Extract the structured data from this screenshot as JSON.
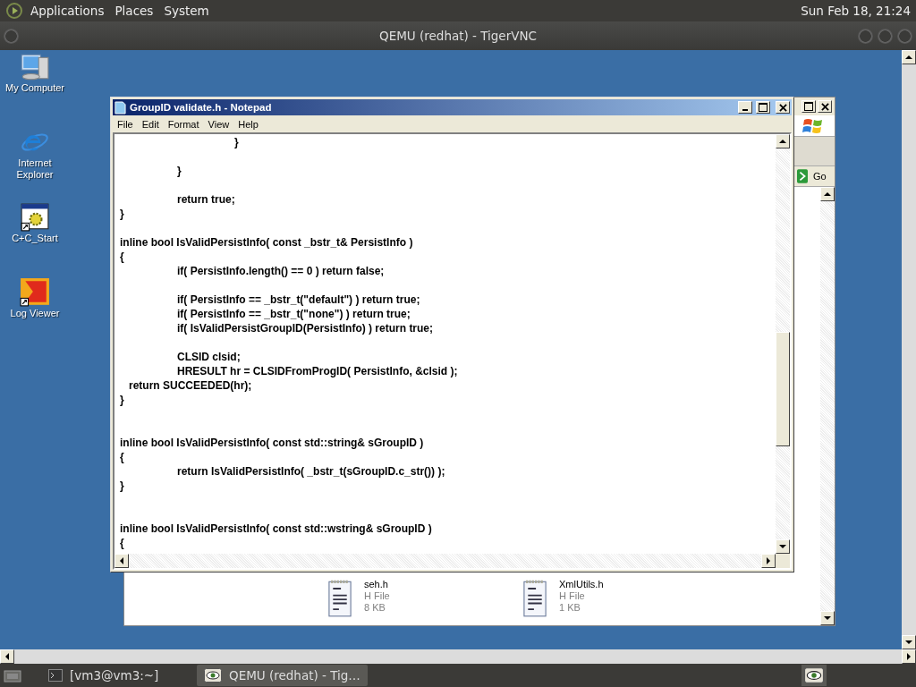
{
  "top_panel": {
    "menus": [
      "Applications",
      "Places",
      "System"
    ],
    "clock": "Sun Feb 18, 21:24"
  },
  "vnc_window": {
    "title": "QEMU (redhat) - TigerVNC"
  },
  "desktop_icons": [
    {
      "label": "My Computer",
      "kind": "computer"
    },
    {
      "label": "Internet Explorer",
      "kind": "browser"
    },
    {
      "label": "C+C_Start",
      "kind": "app"
    },
    {
      "label": "Log Viewer",
      "kind": "viewer"
    }
  ],
  "explorer_window": {
    "go_button": "Go",
    "files": [
      {
        "name": "seh.h",
        "type": "H File",
        "size": "8 KB"
      },
      {
        "name": "XmlUtils.h",
        "type": "H File",
        "size": "1 KB"
      }
    ]
  },
  "notepad": {
    "title": "GroupID validate.h - Notepad",
    "menu": [
      "File",
      "Edit",
      "Format",
      "View",
      "Help"
    ],
    "text": "\t\t}\n\n\t}\n\n\treturn true;\n}\n\ninline bool IsValidPersistInfo( const _bstr_t& PersistInfo )\n{\n\tif( PersistInfo.length() == 0 ) return false;\n\n\tif( PersistInfo == _bstr_t(\"default\") ) return true;\n\tif( PersistInfo == _bstr_t(\"none\") ) return true;\n\tif( IsValidPersistGroupID(PersistInfo) ) return true;\n\n\tCLSID clsid;\n\tHRESULT hr = CLSIDFromProgID( PersistInfo, &clsid );\n   return SUCCEEDED(hr);\n}\n\n\ninline bool IsValidPersistInfo( const std::string& sGroupID )\n{\n\treturn IsValidPersistInfo( _bstr_t(sGroupID.c_str()) );\n}\n\n\ninline bool IsValidPersistInfo( const std::wstring& sGroupID )\n{"
  },
  "taskbar": [
    {
      "label": "[vm3@vm3:~]",
      "kind": "terminal",
      "selected": false
    },
    {
      "label": "QEMU (redhat) - Tig…",
      "kind": "vnc",
      "selected": true
    }
  ]
}
